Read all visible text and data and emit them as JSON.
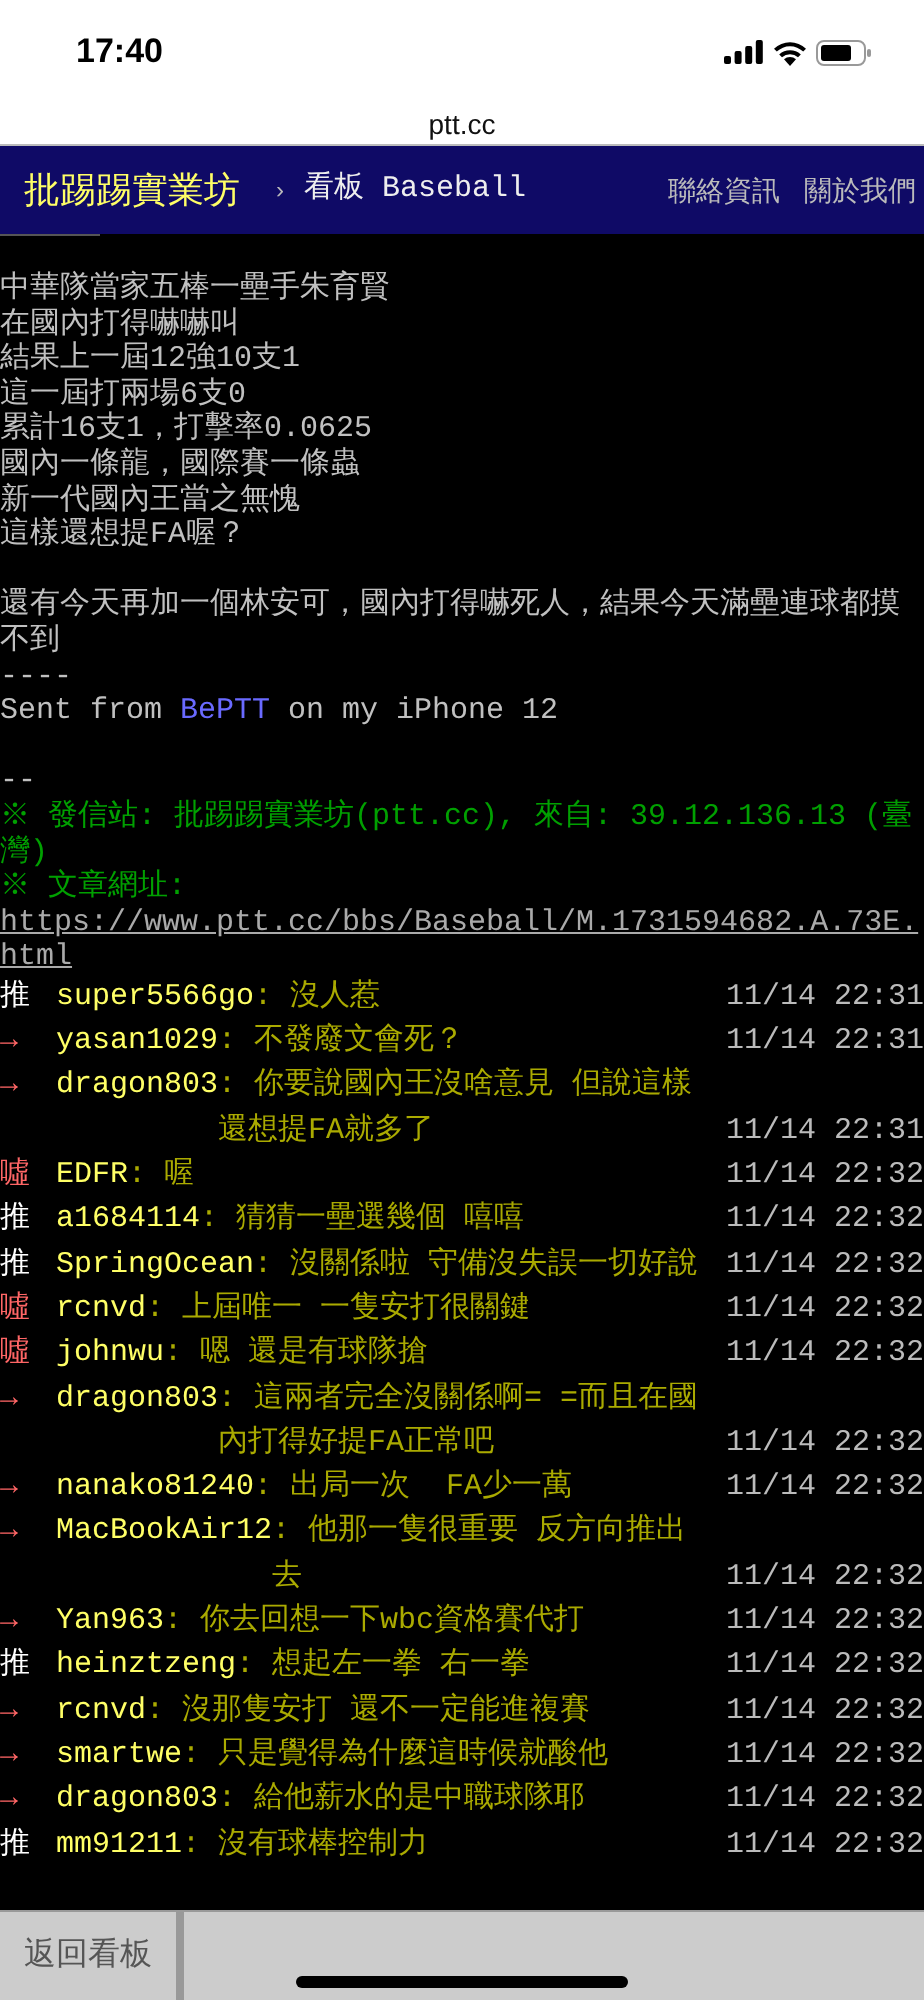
{
  "status_bar": {
    "time": "17:40"
  },
  "address_bar": {
    "url": "ptt.cc"
  },
  "navbar": {
    "brand": "批踢踢實業坊",
    "separator": "›",
    "board": "看板 Baseball",
    "links": [
      "聯絡資訊",
      "關於我們"
    ]
  },
  "article": [
    {
      "kind": "text",
      "text": "中華隊當家五棒一壘手朱育賢"
    },
    {
      "kind": "text",
      "text": "在國內打得嚇嚇叫"
    },
    {
      "kind": "text",
      "text": "結果上一屆12強10支1"
    },
    {
      "kind": "text",
      "text": "這一屆打兩場6支0"
    },
    {
      "kind": "text",
      "text": "累計16支1，打擊率0.0625"
    },
    {
      "kind": "text",
      "text": "國內一條龍，國際賽一條蟲"
    },
    {
      "kind": "text",
      "text": "新一代國內王當之無愧"
    },
    {
      "kind": "text",
      "text": "這樣還想提FA喔？"
    },
    {
      "kind": "blank"
    },
    {
      "kind": "text",
      "text": "還有今天再加一個林安可，國內打得嚇死人，結果今天滿壘連球都摸不到"
    },
    {
      "kind": "text",
      "text": "----"
    },
    {
      "kind": "signature",
      "before": "Sent from ",
      "link": "BePTT",
      "after": " on my iPhone 12"
    },
    {
      "kind": "blank"
    },
    {
      "kind": "text",
      "text": "--"
    },
    {
      "kind": "system",
      "text": "※ 發信站: 批踢踢實業坊(ptt.cc), 來自: 39.12.136.13 (臺灣)"
    },
    {
      "kind": "system",
      "text": "※ 文章網址:"
    },
    {
      "kind": "url",
      "text": "https://www.ptt.cc/bbs/Baseball/M.1731594682.A.73E.html"
    }
  ],
  "pushes": [
    {
      "kind": "push",
      "tag": "推",
      "user": "super5566go",
      "content": ": 沒人惹",
      "time": "11/14 22:31"
    },
    {
      "kind": "neutral",
      "tag": "→",
      "user": "yasan1029",
      "content": ": 不發廢文會死？",
      "time": "11/14 22:31"
    },
    {
      "kind": "neutral",
      "tag": "→",
      "user": "dragon803",
      "content": ": 你要說國內王沒啥意見 但說這樣還想提FA就多了",
      "time": "11/14 22:31"
    },
    {
      "kind": "boo",
      "tag": "噓",
      "user": "EDFR",
      "content": ": 喔",
      "time": "11/14 22:32"
    },
    {
      "kind": "push",
      "tag": "推",
      "user": "a1684114",
      "content": ": 猜猜一壘選幾個 嘻嘻",
      "time": "11/14 22:32"
    },
    {
      "kind": "push",
      "tag": "推",
      "user": "SpringOcean",
      "content": ": 沒關係啦 守備沒失誤一切好說",
      "time": "11/14 22:32"
    },
    {
      "kind": "boo",
      "tag": "噓",
      "user": "rcnvd",
      "content": ": 上屆唯一 一隻安打很關鍵",
      "time": "11/14 22:32"
    },
    {
      "kind": "boo",
      "tag": "噓",
      "user": "johnwu",
      "content": ": 嗯 還是有球隊搶",
      "time": "11/14 22:32"
    },
    {
      "kind": "neutral",
      "tag": "→",
      "user": "dragon803",
      "content": ": 這兩者完全沒關係啊= =而且在國內打得好提FA正常吧",
      "time": "11/14 22:32"
    },
    {
      "kind": "neutral",
      "tag": "→",
      "user": "nanako81240",
      "content": ": 出局一次  FA少一萬",
      "time": "11/14 22:32"
    },
    {
      "kind": "neutral",
      "tag": "→",
      "user": "MacBookAir12",
      "content": ": 他那一隻很重要 反方向推出去",
      "time": "11/14 22:32"
    },
    {
      "kind": "neutral",
      "tag": "→",
      "user": "Yan963",
      "content": ": 你去回想一下wbc資格賽代打",
      "time": "11/14 22:32"
    },
    {
      "kind": "push",
      "tag": "推",
      "user": "heinztzeng",
      "content": ": 想起左一拳 右一拳",
      "time": "11/14 22:32"
    },
    {
      "kind": "neutral",
      "tag": "→",
      "user": "rcnvd",
      "content": ": 沒那隻安打 還不一定能進複賽",
      "time": "11/14 22:32"
    },
    {
      "kind": "neutral",
      "tag": "→",
      "user": "smartwe",
      "content": ": 只是覺得為什麼這時候就酸他",
      "time": "11/14 22:32"
    },
    {
      "kind": "neutral",
      "tag": "→",
      "user": "dragon803",
      "content": ": 給他薪水的是中職球隊耶",
      "time": "11/14 22:32"
    },
    {
      "kind": "push",
      "tag": "推",
      "user": "mm91211",
      "content": ": 沒有球棒控制力",
      "time": "11/14 22:32"
    }
  ],
  "bottom_bar": {
    "back_button": "返回看板"
  }
}
